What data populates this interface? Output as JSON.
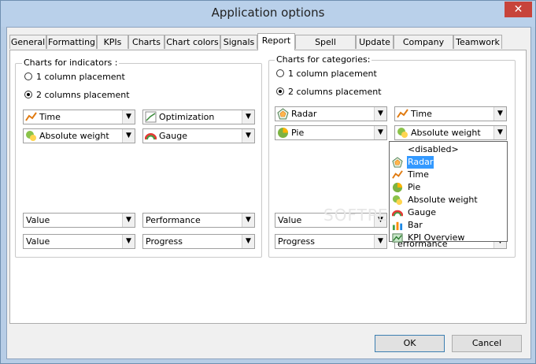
{
  "window": {
    "title": "Application options",
    "close": "✕"
  },
  "tabs": [
    {
      "label": "General"
    },
    {
      "label": "Formatting"
    },
    {
      "label": "KPIs"
    },
    {
      "label": "Charts"
    },
    {
      "label": "Chart colors"
    },
    {
      "label": "Signals"
    },
    {
      "label": "Report"
    },
    {
      "label": "Spell checking"
    },
    {
      "label": "Update"
    },
    {
      "label": "Company info"
    },
    {
      "label": "Teamwork"
    }
  ],
  "active_tab": "Report",
  "indicators": {
    "title": "Charts for indicators :",
    "radio1": "1 column placement",
    "radio2": "2 columns placement",
    "selected": "2 columns placement",
    "combo_a1": "Time",
    "combo_a2": "Optimization",
    "combo_b1": "Absolute weight",
    "combo_b2": "Gauge",
    "combo_c1": "Value",
    "combo_c2": "Performance",
    "combo_d1": "Value",
    "combo_d2": "Progress"
  },
  "categories": {
    "title": "Charts for categories:",
    "radio1": "1 column placement",
    "radio2": "2 columns placement",
    "selected": "2 columns placement",
    "combo_a1": "Radar",
    "combo_a2": "Time",
    "combo_b1": "Pie",
    "combo_b2": "Absolute weight",
    "combo_c1": "Value",
    "combo_d1": "Progress",
    "combo_d2_partial": "erformance"
  },
  "dropdown": {
    "items": [
      "<disabled>",
      "Radar",
      "Time",
      "Pie",
      "Absolute weight",
      "Gauge",
      "Bar",
      "KPI Overview"
    ],
    "highlighted": "Radar"
  },
  "buttons": {
    "ok": "OK",
    "cancel": "Cancel"
  },
  "arrow_glyph": "▼",
  "watermark": "SOFTPEDIA",
  "colors": {
    "selection": "#3399ff",
    "title_bar": "#b9d0ea",
    "close_button": "#c7443b"
  }
}
